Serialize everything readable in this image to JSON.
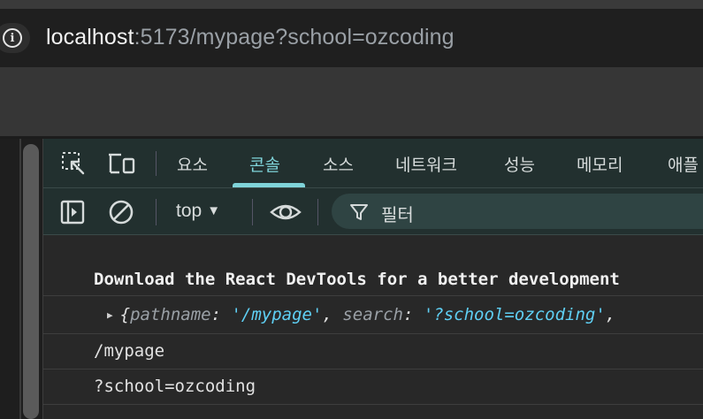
{
  "browser": {
    "url_host": "localhost",
    "url_rest": ":5173/mypage?school=ozcoding"
  },
  "devtools": {
    "tabs": [
      {
        "label": "요소"
      },
      {
        "label": "콘솔"
      },
      {
        "label": "소스"
      },
      {
        "label": "네트워크"
      },
      {
        "label": "성능"
      },
      {
        "label": "메모리"
      },
      {
        "label": "애플"
      }
    ],
    "active_tab": "콘솔",
    "toolbar": {
      "context": "top",
      "filter_placeholder": "필터"
    },
    "console": {
      "message_1": "Download the React DevTools for a better development",
      "object_open": "{",
      "object_key1": "pathname",
      "object_sep1": ": ",
      "object_val1": "'/mypage'",
      "object_comma1": ", ",
      "object_key2": "search",
      "object_sep2": ": ",
      "object_val2": "'?school=ozcoding'",
      "object_comma2": ",",
      "line_pathname": "/mypage",
      "line_search": "?school=ozcoding"
    }
  },
  "colors": {
    "accent": "#7fd3d9",
    "string_value": "#5fd0f5",
    "panel_bg": "#22302f"
  },
  "icons": [
    "info-icon",
    "inspect-element-icon",
    "device-toolbar-icon",
    "sidebar-toggle-icon",
    "clear-console-icon",
    "live-expression-eye-icon",
    "filter-funnel-icon",
    "expand-triangle-icon"
  ]
}
